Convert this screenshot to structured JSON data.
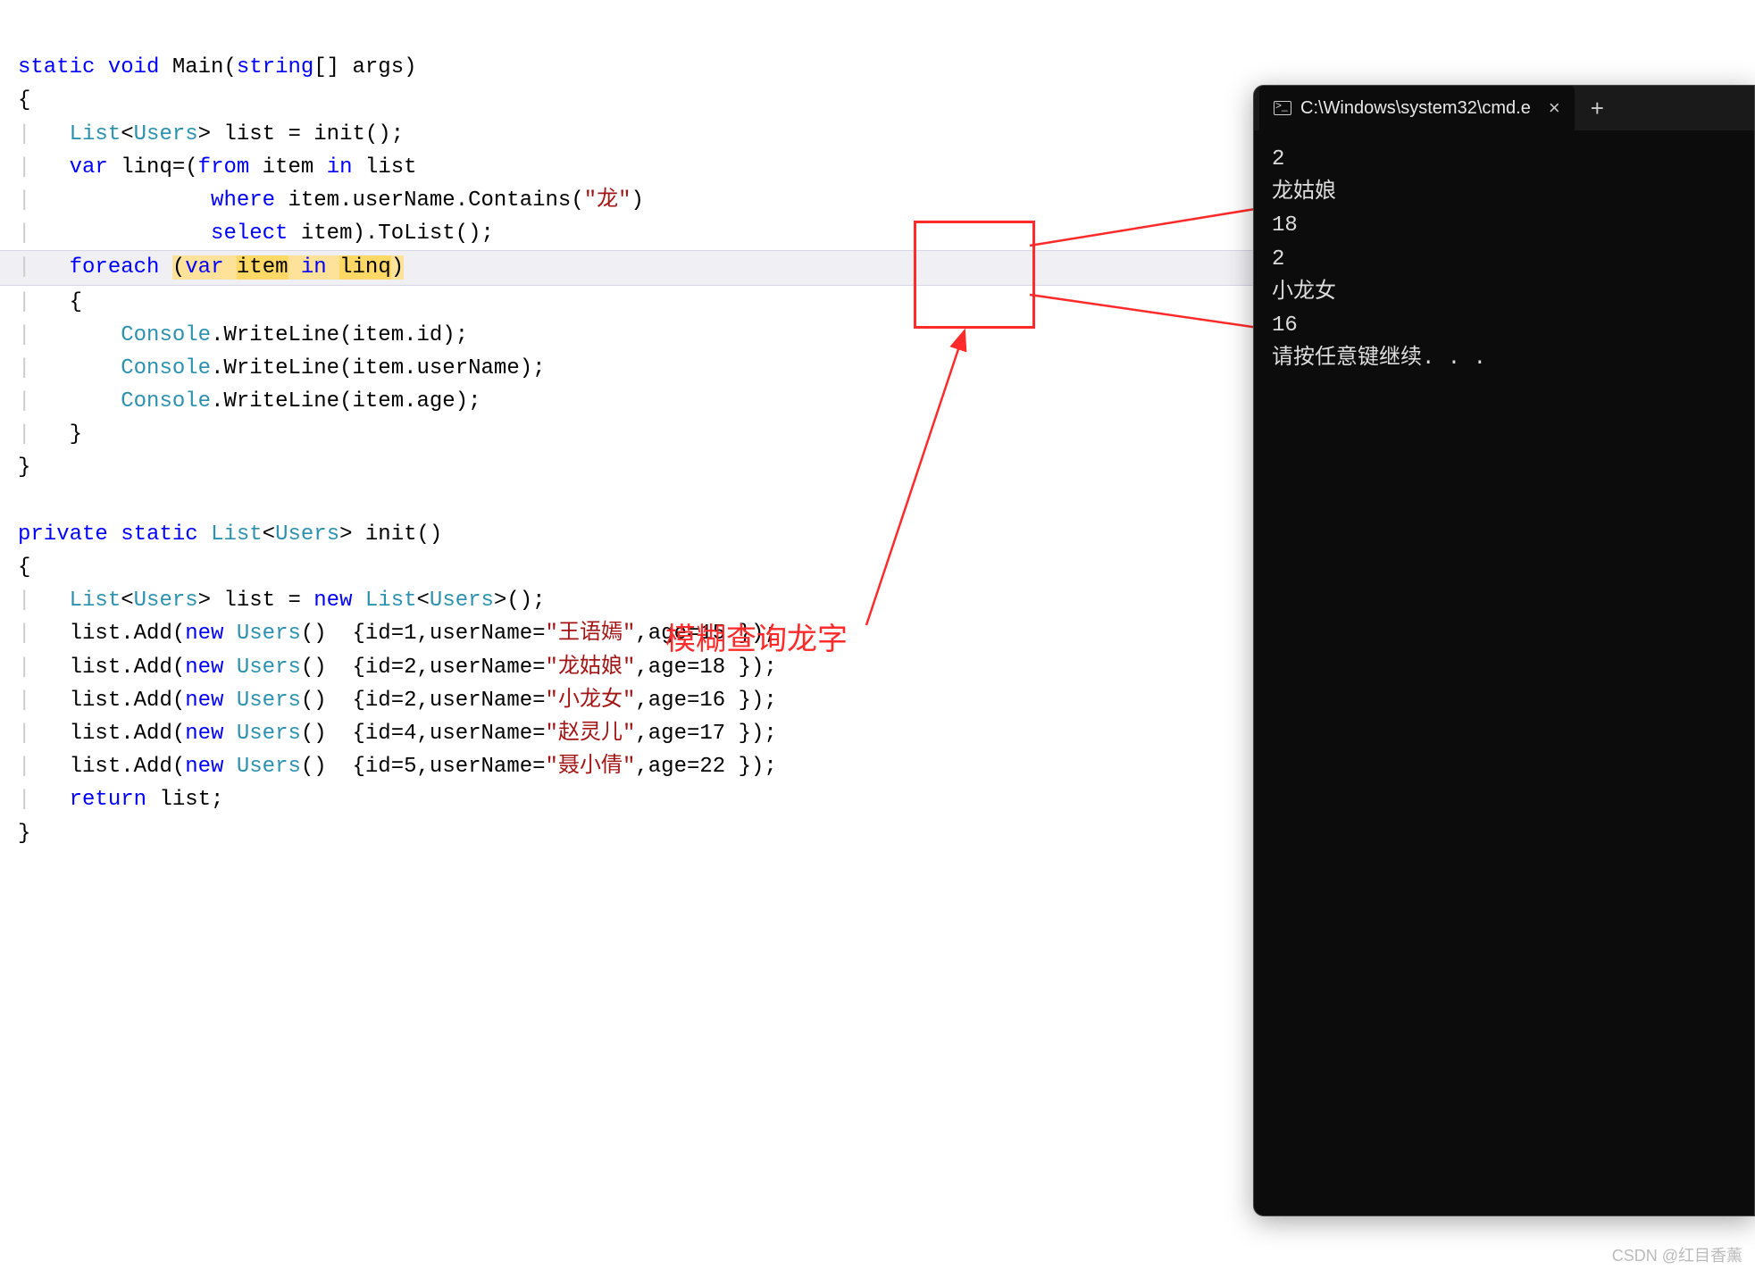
{
  "code": {
    "l1": {
      "a": "static",
      "b": "void",
      "c": "Main(",
      "d": "string",
      "e": "[] args)"
    },
    "l2": "{",
    "l3": {
      "a": "List",
      "b": "<",
      "c": "Users",
      "d": "> list = init();"
    },
    "l4": {
      "a": "var",
      "b": " linq=(",
      "c": "from",
      "d": " item ",
      "e": "in",
      "f": " list"
    },
    "l5": {
      "a": "where",
      "b": " item.userName.Contains(",
      "c": "\"龙\"",
      "d": ")"
    },
    "l6": {
      "a": "select",
      "b": " item).ToList();"
    },
    "l7": {
      "a": "foreach",
      "b": " ",
      "c": "(",
      "d": "var",
      "e": " ",
      "f": "item",
      "g": " ",
      "h": "in",
      "i": " ",
      "j": "linq",
      "k": ")"
    },
    "l8": "{",
    "l9": {
      "a": "Console",
      "b": ".WriteLine(item.id);"
    },
    "l10": {
      "a": "Console",
      "b": ".WriteLine(item.userName);"
    },
    "l11": {
      "a": "Console",
      "b": ".WriteLine(item.age);"
    },
    "l12": "}",
    "l13": "}",
    "l14": {
      "a": "private",
      "b": "static",
      "c": "List",
      "d": "<",
      "e": "Users",
      "f": "> init()"
    },
    "l15": "{",
    "l16": {
      "a": "List",
      "b": "<",
      "c": "Users",
      "d": "> list = ",
      "e": "new",
      "f": " ",
      "g": "List",
      "h": "<",
      "i": "Users",
      "j": ">();"
    },
    "l17": {
      "a": "list.Add(",
      "b": "new",
      "c": " ",
      "d": "Users",
      "e": "()  {id=1,userName=",
      "f": "\"王语嫣\"",
      "g": ",age=15 });"
    },
    "l18": {
      "a": "list.Add(",
      "b": "new",
      "c": " ",
      "d": "Users",
      "e": "()  {id=2,userName=",
      "f": "\"龙姑娘\"",
      "g": ",age=18 });"
    },
    "l19": {
      "a": "list.Add(",
      "b": "new",
      "c": " ",
      "d": "Users",
      "e": "()  {id=2,userName=",
      "f": "\"小龙女\"",
      "g": ",age=16 });"
    },
    "l20": {
      "a": "list.Add(",
      "b": "new",
      "c": " ",
      "d": "Users",
      "e": "()  {id=4,userName=",
      "f": "\"赵灵儿\"",
      "g": ",age=17 });"
    },
    "l21": {
      "a": "list.Add(",
      "b": "new",
      "c": " ",
      "d": "Users",
      "e": "()  {id=5,userName=",
      "f": "\"聂小倩\"",
      "g": ",age=22 });"
    },
    "l22": {
      "a": "return",
      "b": " list;"
    },
    "l23": "}"
  },
  "annotation": {
    "label": "模糊查询龙字"
  },
  "terminal": {
    "title": "C:\\Windows\\system32\\cmd.e",
    "close": "×",
    "plus": "+",
    "lines": [
      "2",
      "龙姑娘",
      "18",
      "2",
      "小龙女",
      "16",
      "请按任意键继续. . ."
    ]
  },
  "watermark": "CSDN @红目香薰"
}
